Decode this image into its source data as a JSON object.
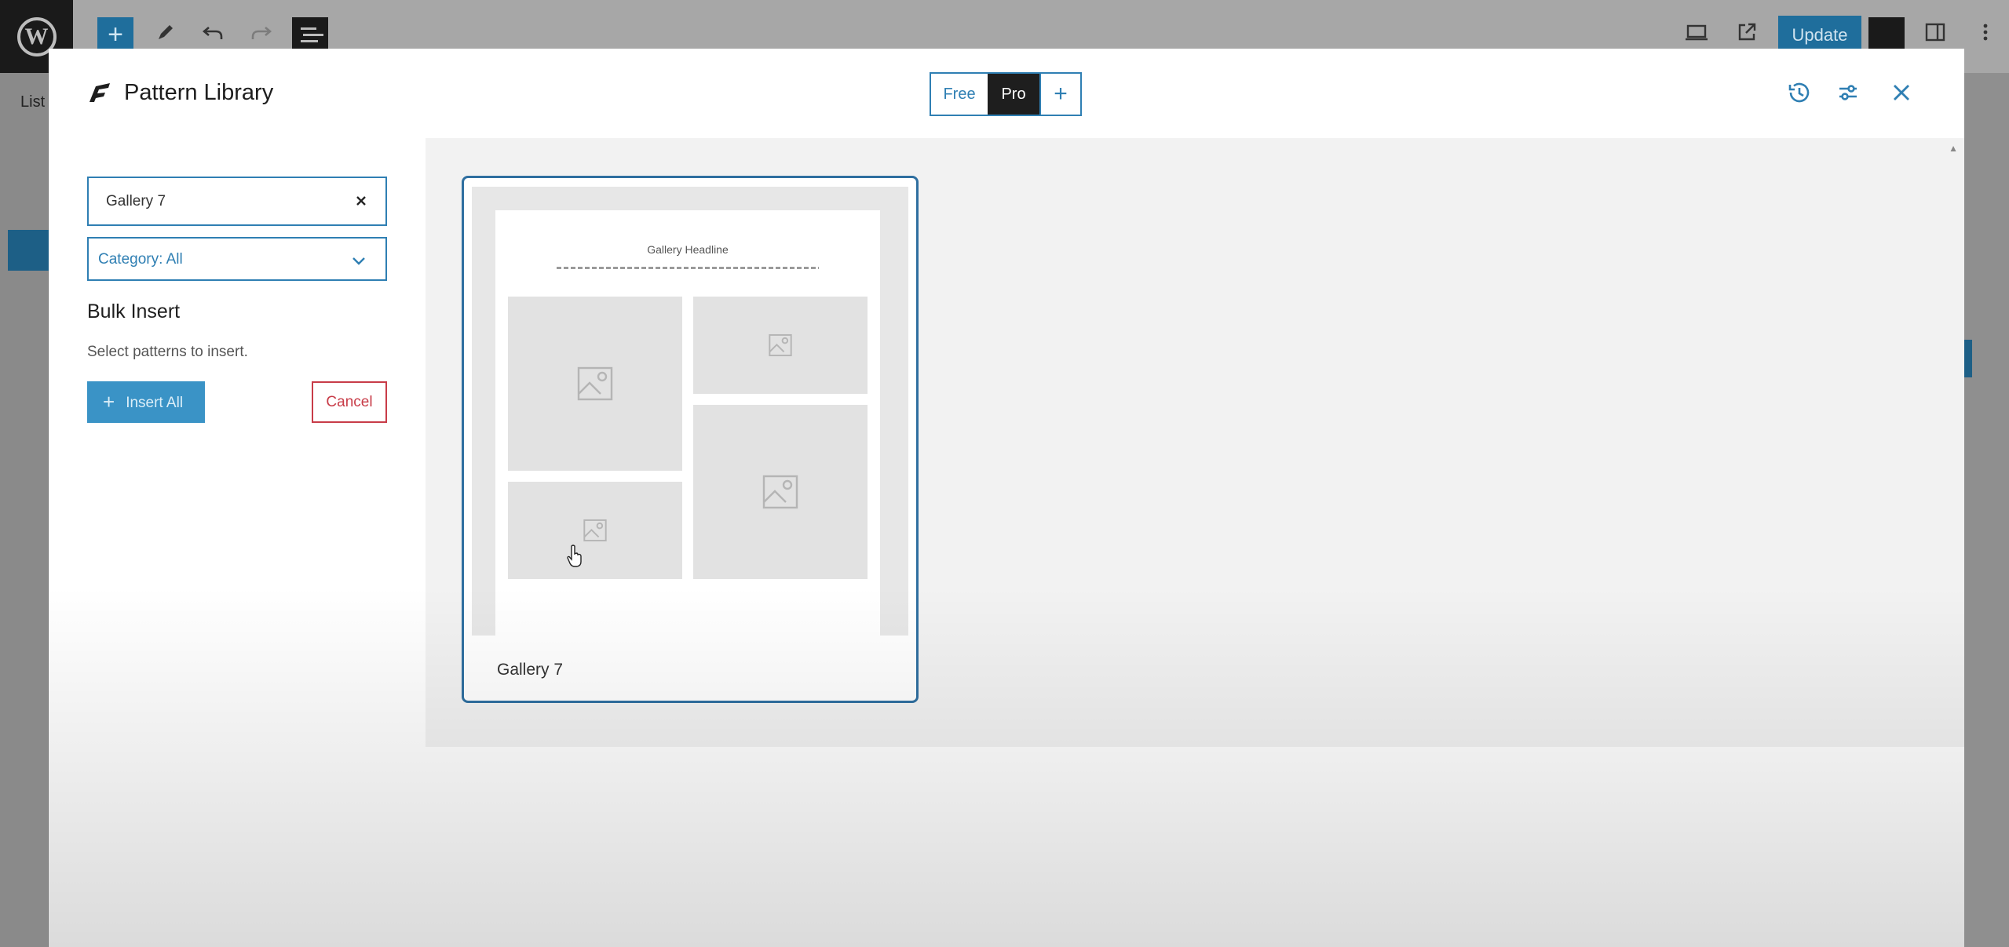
{
  "editor": {
    "update_label": "Update",
    "list_tab_label": "List"
  },
  "modal": {
    "title": "Pattern Library",
    "tabs": {
      "free": "Free",
      "pro": "Pro",
      "add": "+"
    },
    "active_tab": "Pro"
  },
  "sidebar": {
    "search_value": "Gallery 7",
    "category_label": "Category: All",
    "bulk_title": "Bulk Insert",
    "bulk_desc": "Select patterns to insert.",
    "insert_all_label": "Insert All",
    "cancel_label": "Cancel"
  },
  "patterns": [
    {
      "name": "Gallery 7",
      "preview_headline": "Gallery Headline"
    }
  ],
  "colors": {
    "accent": "#2f7fb3",
    "danger": "#c83c48",
    "dark": "#1e1e1e"
  }
}
